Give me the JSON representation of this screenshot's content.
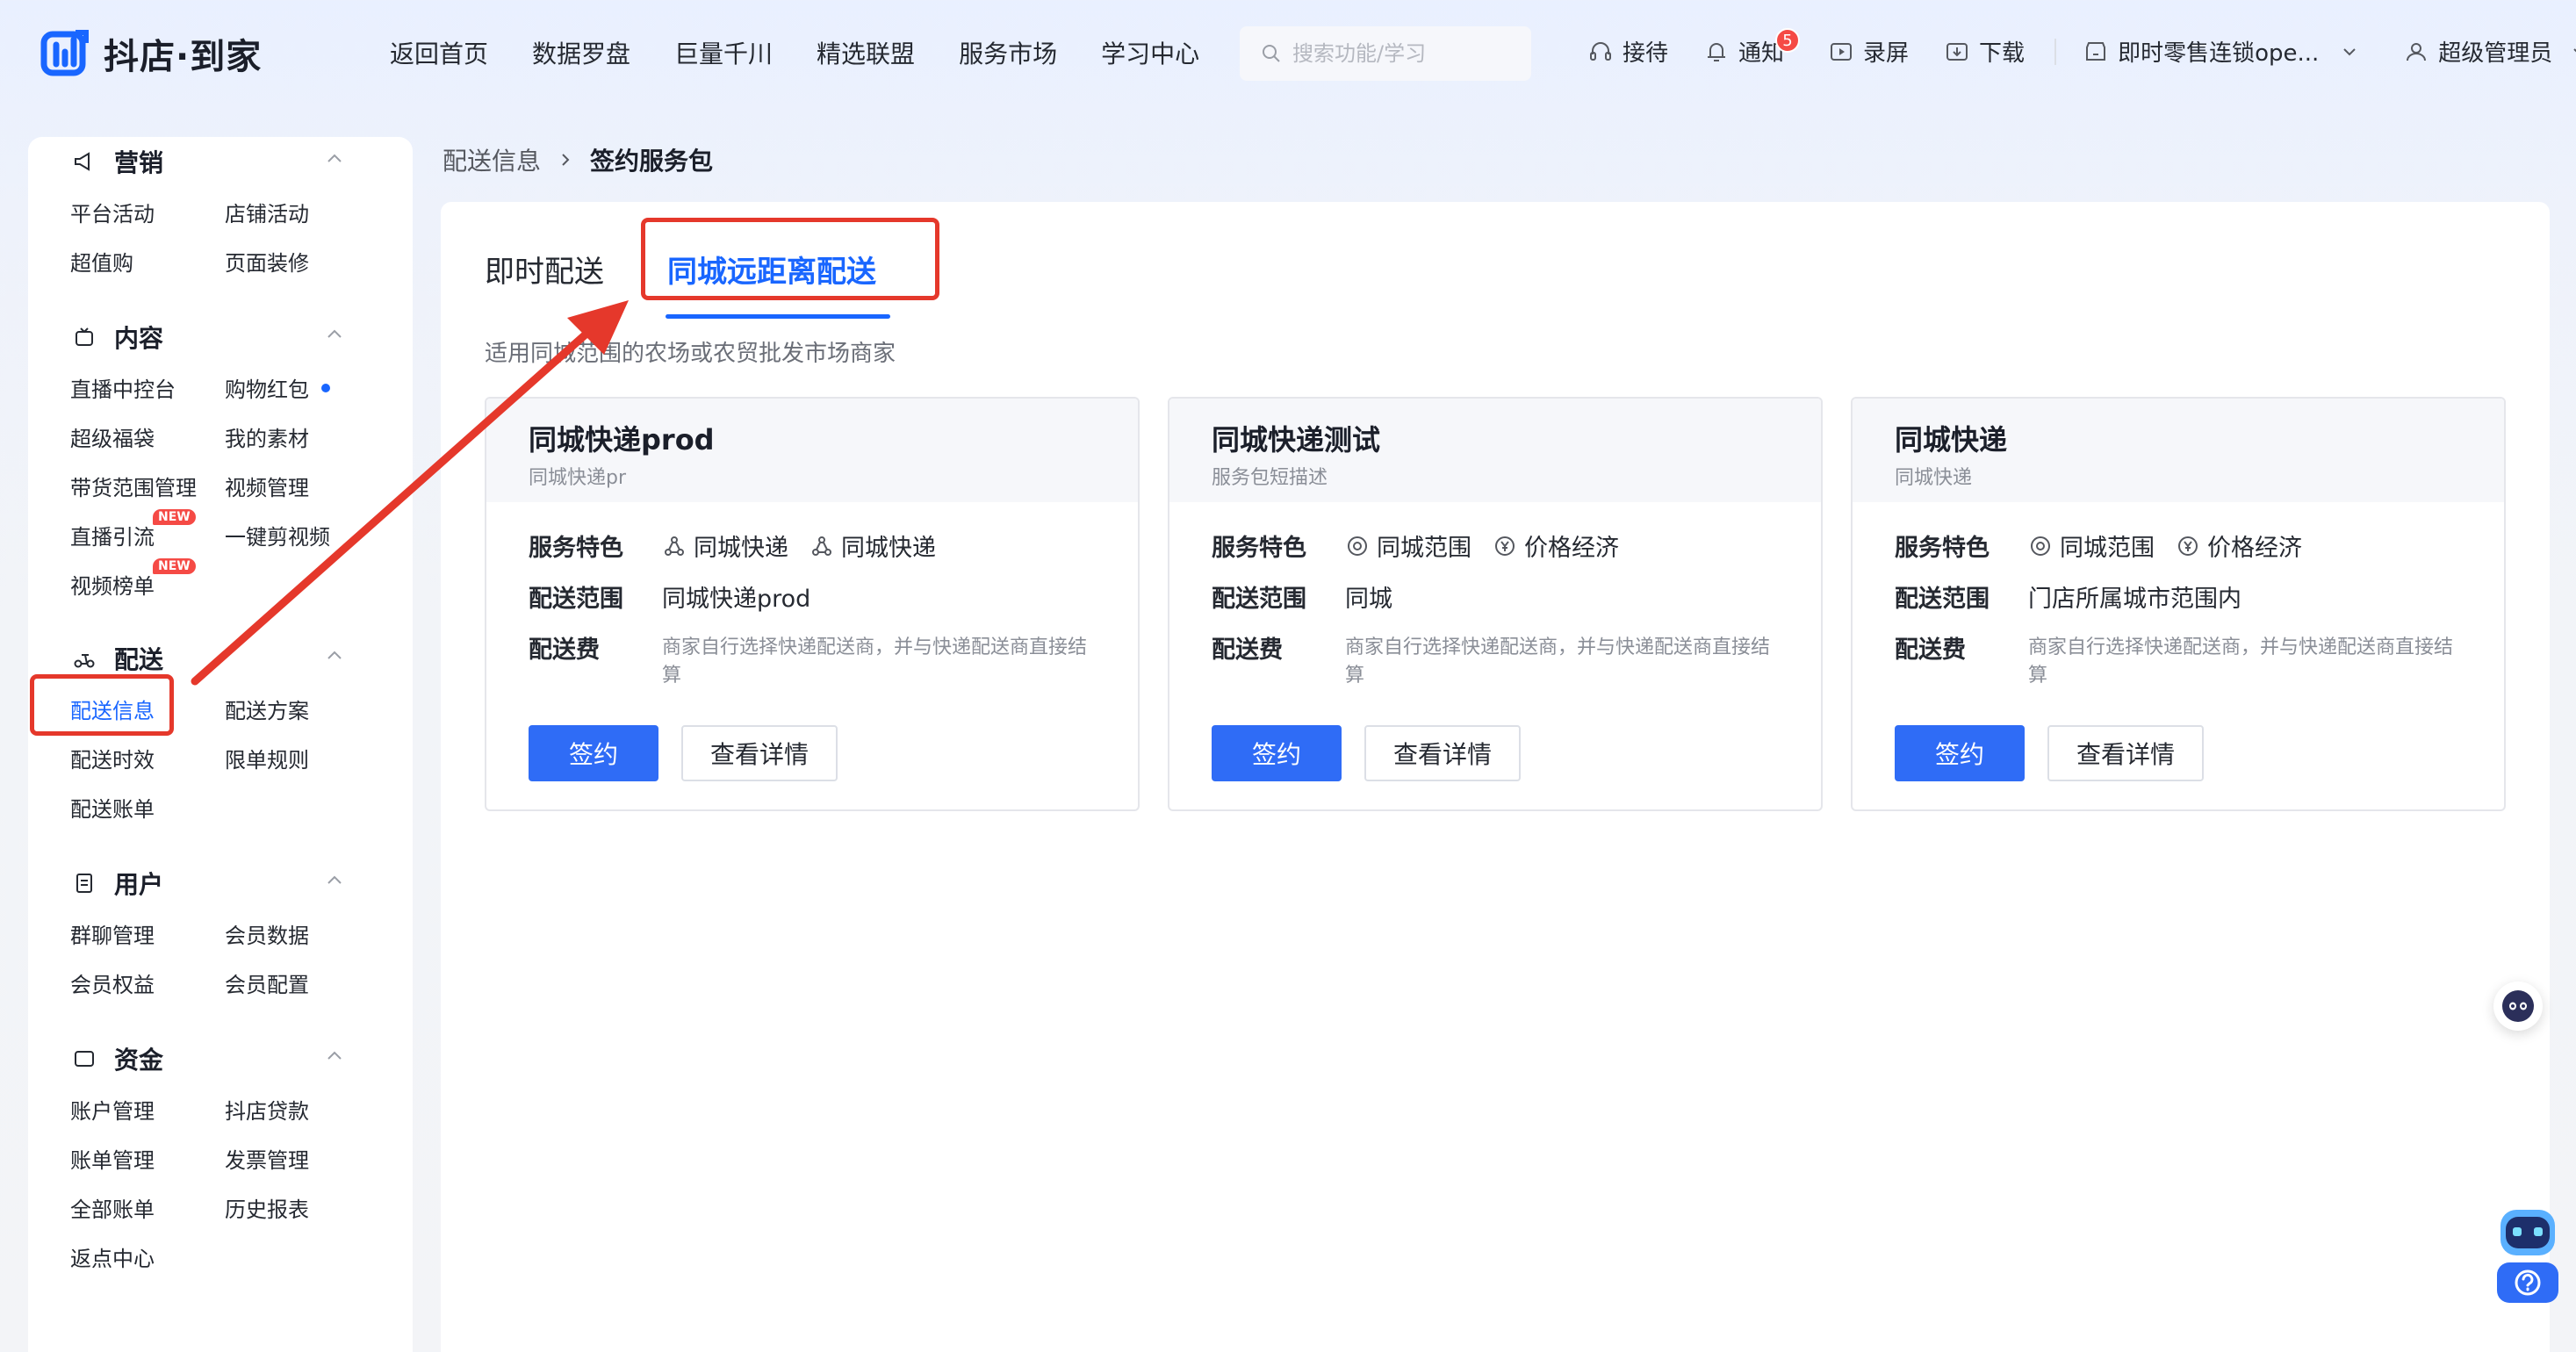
{
  "header": {
    "logo_text": "抖店·到家",
    "nav": [
      "返回首页",
      "数据罗盘",
      "巨量千川",
      "精选联盟",
      "服务市场",
      "学习中心"
    ],
    "search_placeholder": "搜索功能/学习",
    "tools": {
      "reception": "接待",
      "notify": "通知",
      "notify_count": "5",
      "record": "录屏",
      "download": "下载"
    },
    "store_name": "即时零售连锁ope...",
    "user_name": "超级管理员"
  },
  "sidebar": {
    "marketing": {
      "title": "营销",
      "items": [
        "平台活动",
        "店铺活动",
        "超值购",
        "页面装修"
      ]
    },
    "content": {
      "title": "内容",
      "items": [
        "直播中控台",
        "购物红包",
        "超级福袋",
        "我的素材",
        "带货范围管理",
        "视频管理",
        "直播引流",
        "一键剪视频",
        "视频榜单"
      ],
      "new_tag": "NEW"
    },
    "delivery": {
      "title": "配送",
      "items": [
        "配送信息",
        "配送方案",
        "配送时效",
        "限单规则",
        "配送账单"
      ]
    },
    "users": {
      "title": "用户",
      "items": [
        "群聊管理",
        "会员数据",
        "会员权益",
        "会员配置"
      ]
    },
    "funds": {
      "title": "资金",
      "items": [
        "账户管理",
        "抖店贷款",
        "账单管理",
        "发票管理",
        "全部账单",
        "历史报表",
        "返点中心"
      ]
    }
  },
  "breadcrumb": {
    "parent": "配送信息",
    "current": "签约服务包"
  },
  "tabs": {
    "instant": "即时配送",
    "long_distance": "同城远距离配送"
  },
  "description": "适用同城范围的农场或农贸批发市场商家",
  "labels": {
    "features": "服务特色",
    "range": "配送范围",
    "fee": "配送费",
    "sign": "签约",
    "detail": "查看详情"
  },
  "cards": [
    {
      "title": "同城快递prod",
      "subtitle": "同城快递pr",
      "features": [
        "同城快递",
        "同城快递"
      ],
      "range": "同城快递prod",
      "fee": "商家自行选择快递配送商，并与快递配送商直接结算"
    },
    {
      "title": "同城快递测试",
      "subtitle": "服务包短描述",
      "features": [
        "同城范围",
        "价格经济"
      ],
      "range": "同城",
      "fee": "商家自行选择快递配送商，并与快递配送商直接结算"
    },
    {
      "title": "同城快递",
      "subtitle": "同城快递",
      "features": [
        "同城范围",
        "价格经济"
      ],
      "range": "门店所属城市范围内",
      "fee": "商家自行选择快递配送商，并与快递配送商直接结算"
    }
  ],
  "colors": {
    "primary": "#1966ff",
    "button": "#2f6cf6",
    "annotation": "#e5382b",
    "badge": "#f54a45"
  }
}
